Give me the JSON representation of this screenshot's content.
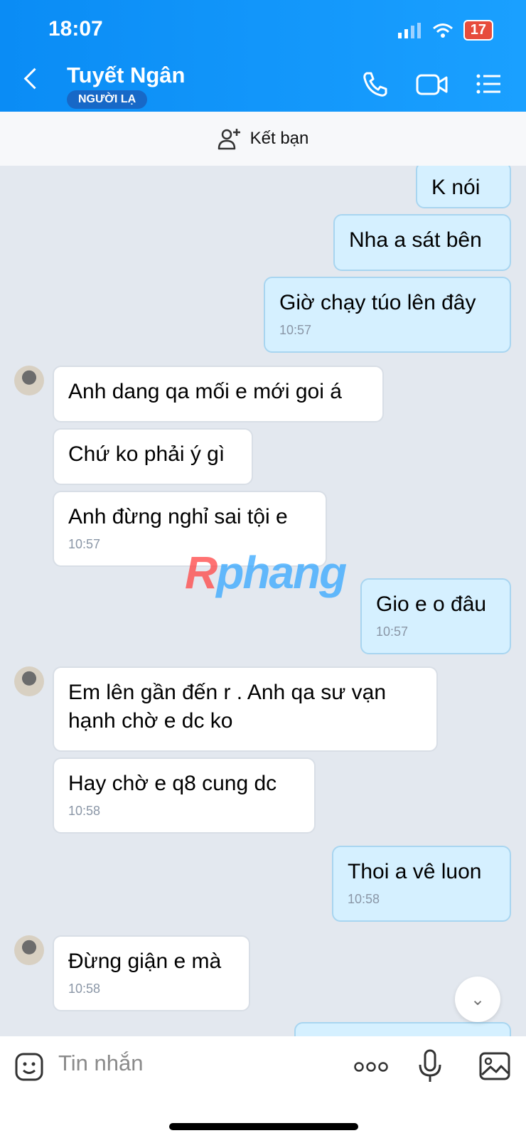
{
  "status_bar": {
    "time": "18:07",
    "battery": "17"
  },
  "header": {
    "name": "Tuyết Ngân",
    "badge": "NGƯỜI LẠ"
  },
  "friend_bar": {
    "label": "Kết bạn"
  },
  "messages": [
    {
      "from": "me",
      "text": "K nói",
      "time": ""
    },
    {
      "from": "me",
      "text": "Nha a sát bên",
      "time": ""
    },
    {
      "from": "me",
      "text": "Giờ chạy túo lên đây",
      "time": "10:57"
    },
    {
      "from": "them",
      "text": "Anh dang qa mối e mới goi á",
      "time": ""
    },
    {
      "from": "them",
      "text": "Chứ ko phải ý gì",
      "time": ""
    },
    {
      "from": "them",
      "text": "Anh đừng nghỉ sai tội e",
      "time": "10:57"
    },
    {
      "from": "me",
      "text": "Gio e o đâu",
      "time": "10:57"
    },
    {
      "from": "them",
      "text": "Em lên gần đến r . Anh qa sư vạn hạnh chờ e dc ko",
      "time": ""
    },
    {
      "from": "them",
      "text": "Hay chờ e q8 cung dc",
      "time": "10:58"
    },
    {
      "from": "me",
      "text": "Thoi a vê luon",
      "time": "10:58"
    },
    {
      "from": "them",
      "text": "Đừng giận e mà",
      "time": "10:58"
    }
  ],
  "watermark": {
    "part1": "R",
    "part2": "phang"
  },
  "input": {
    "placeholder": "Tin nhắn"
  },
  "colors": {
    "header": "#0a8cf5",
    "sent_bubble": "#d5f0ff",
    "received_bubble": "#ffffff",
    "background": "#e3e8ef"
  }
}
